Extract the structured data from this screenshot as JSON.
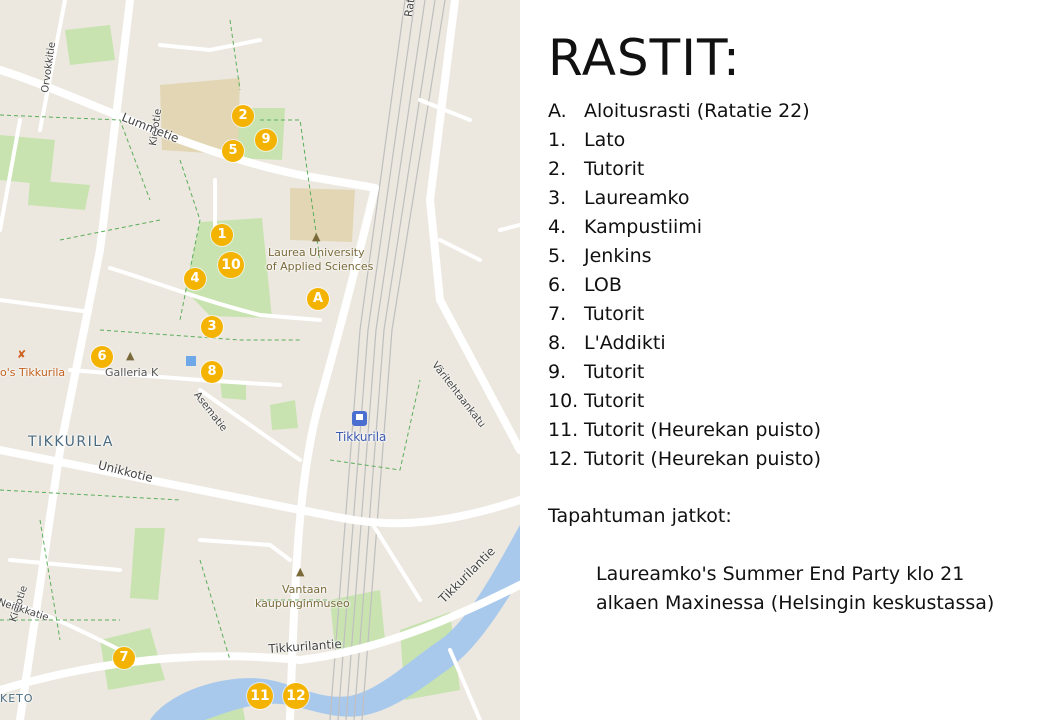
{
  "map": {
    "street_labels": {
      "ratatie": "Ratatie",
      "orvokkitie": "Orvokkitie",
      "kielotie_top": "Kielotie",
      "lummetie": "Lummetie",
      "asematie": "Asematie",
      "unikkotie": "Unikkotie",
      "kielotie_bottom": "Kielotie",
      "neilikkatie": "Neilikkatie",
      "tikkurilantie_1": "Tikkurilantie",
      "tikkurilantie_2": "Tikkurilantie",
      "varitehtaankatu": "Väritehtaankatu"
    },
    "places": {
      "laurea_1": "Laurea University",
      "laurea_2": "of Applied Sciences",
      "galleria": "Galleria K",
      "restaurant": "o's Tikkurila",
      "district": "TIKKURILA",
      "station": "Tikkurila",
      "museum_1": "Vantaan",
      "museum_2": "kaupunginmuseo",
      "keto": "KETO"
    },
    "markers": {
      "m_a": "A",
      "m_1": "1",
      "m_2": "2",
      "m_3": "3",
      "m_4": "4",
      "m_5": "5",
      "m_6": "6",
      "m_7": "7",
      "m_8": "8",
      "m_9": "9",
      "m_10": "10",
      "m_11": "11",
      "m_12": "12"
    },
    "colors": {
      "marker": "#f5b301",
      "park": "#c8e3b0",
      "water": "#a9c9ec",
      "road": "#ffffff",
      "path": "#5cae5c"
    }
  },
  "panel": {
    "title": "RASTIT:",
    "items": [
      {
        "key": "A.",
        "text": "Aloitusrasti (Ratatie 22)"
      },
      {
        "key": "1.",
        "text": "Lato"
      },
      {
        "key": "2.",
        "text": "Tutorit"
      },
      {
        "key": "3.",
        "text": "Laureamko"
      },
      {
        "key": "4.",
        "text": "Kampustiimi"
      },
      {
        "key": "5.",
        "text": "Jenkins"
      },
      {
        "key": "6.",
        "text": "LOB"
      },
      {
        "key": "7.",
        "text": "Tutorit"
      },
      {
        "key": "8.",
        "text": "L'Addikti"
      },
      {
        "key": "9.",
        "text": "Tutorit"
      },
      {
        "key": "10.",
        "text": "Tutorit"
      },
      {
        "key": "11.",
        "text": "Tutorit (Heurekan puisto)"
      },
      {
        "key": "12.",
        "text": "Tutorit (Heurekan puisto)"
      }
    ],
    "followup_heading": "Tapahtuman jatkot:",
    "followup_text": "Laureamko's Summer End Party klo 21 alkaen Maxinessa (Helsingin keskustassa)"
  }
}
